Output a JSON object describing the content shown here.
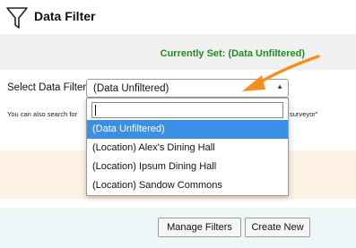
{
  "header": {
    "title": "Data Filter",
    "icon": "funnel-icon"
  },
  "status": {
    "text": "Currently Set: (Data Unfiltered)",
    "color": "#1e8f1e"
  },
  "filter": {
    "label": "Select Data Filter:",
    "selected": "(Data Unfiltered)",
    "search_value": "",
    "options": [
      "(Data Unfiltered)",
      "(Location) Alex's Dining Hall",
      "(Location) Ipsum Dining Hall",
      "(Location) Sandow Commons"
    ]
  },
  "hint": {
    "left": "You can also search for",
    "right": "surveyor\""
  },
  "actions": {
    "manage_label": "Manage Filters",
    "create_label": "Create New"
  },
  "colors": {
    "arrow": "#f5901e",
    "highlight": "#3b8fe5"
  }
}
